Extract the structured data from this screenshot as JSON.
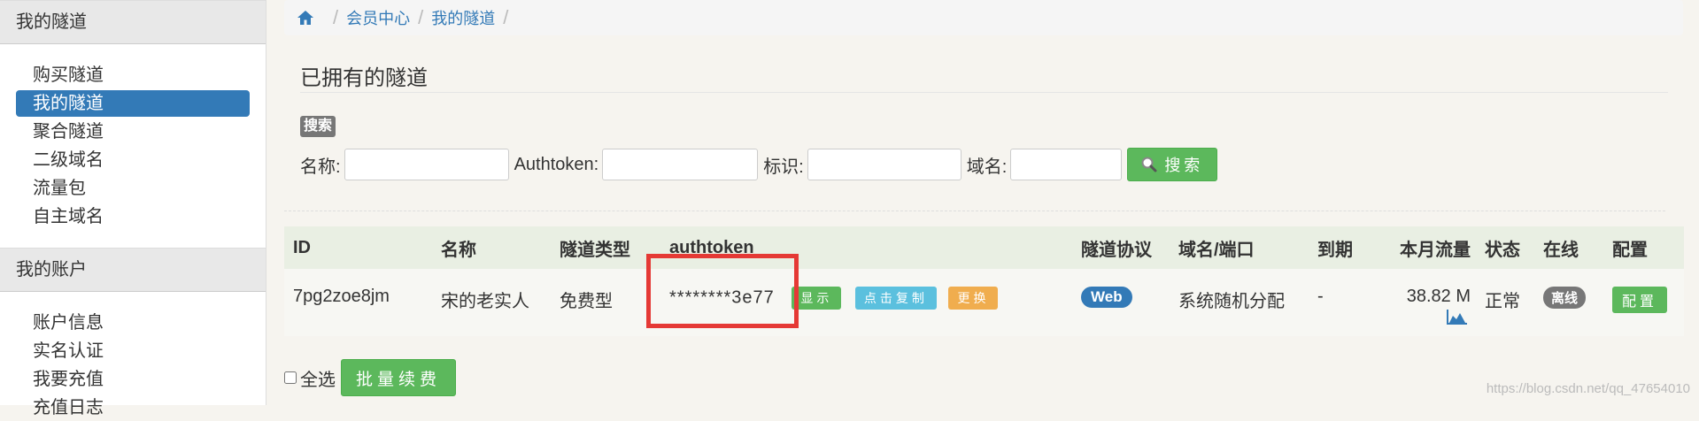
{
  "sidebar": {
    "section1_title": "我的隧道",
    "section1_items": [
      {
        "label": "购买隧道"
      },
      {
        "label": "我的隧道",
        "active": true
      },
      {
        "label": "聚合隧道"
      },
      {
        "label": "二级域名"
      },
      {
        "label": "流量包"
      },
      {
        "label": "自主域名"
      }
    ],
    "section2_title": "我的账户",
    "section2_items": [
      {
        "label": "账户信息"
      },
      {
        "label": "实名认证"
      },
      {
        "label": "我要充值"
      },
      {
        "label": "充值日志"
      }
    ]
  },
  "breadcrumb": {
    "icon": "home-icon",
    "items": [
      "会员中心",
      "我的隧道"
    ]
  },
  "page_title": "已拥有的隧道",
  "search": {
    "badge": "搜索",
    "name_label": "名称:",
    "name_value": "",
    "authtoken_label": "Authtoken:",
    "authtoken_value": "",
    "tag_label": "标识:",
    "tag_value": "",
    "domain_label": "域名:",
    "domain_value": "",
    "button_label": "搜索",
    "button_icon": "search-icon"
  },
  "table": {
    "headers": {
      "id": "ID",
      "name": "名称",
      "type": "隧道类型",
      "authtoken": "authtoken",
      "protocol": "隧道协议",
      "domain": "域名/端口",
      "expire": "到期",
      "traffic": "本月流量",
      "status": "状态",
      "online": "在线",
      "config": "配置"
    },
    "rows": [
      {
        "id": "7pg2zoe8jm",
        "name": "宋的老实人",
        "type": "免费型",
        "authtoken": "********3e77",
        "show_label": "显示",
        "copy_label": "点击复制",
        "change_label": "更换",
        "protocol": "Web",
        "domain": "系统随机分配",
        "expire": "-",
        "traffic": "38.82 M",
        "status": "正常",
        "online": "离线",
        "config_label": "配置"
      }
    ]
  },
  "bottom": {
    "select_all_label": "全选",
    "renew_label": "批量续费"
  },
  "watermark": "https://blog.csdn.net/qq_47654010",
  "colors": {
    "primary": "#337ab7",
    "success": "#5cb85c",
    "info": "#5bc0de",
    "warning": "#f0ad4e",
    "highlight": "#e53935"
  }
}
